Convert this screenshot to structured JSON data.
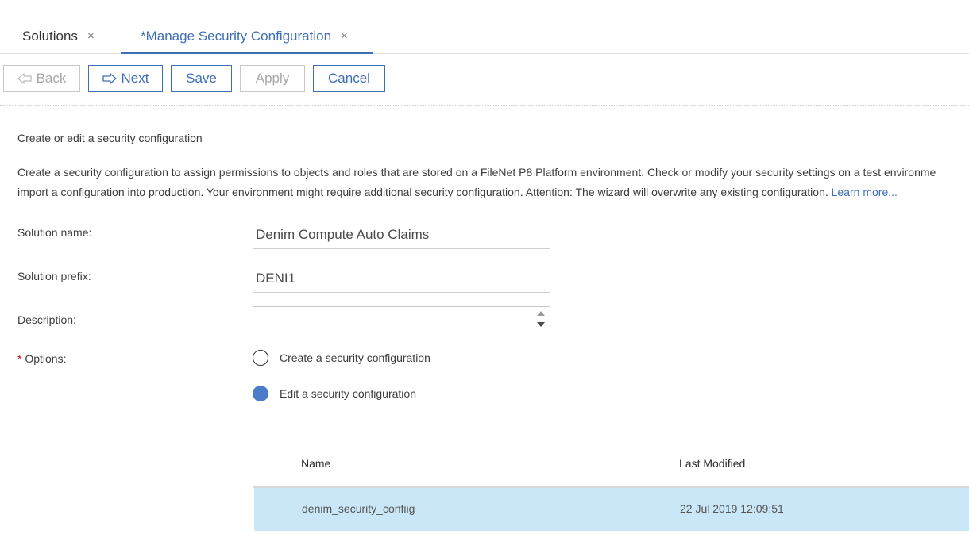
{
  "tabs": [
    {
      "label": "Solutions",
      "close": "×"
    },
    {
      "label": "*Manage Security Configuration",
      "close": "×"
    }
  ],
  "toolbar": {
    "back": "Back",
    "next": "Next",
    "save": "Save",
    "apply": "Apply",
    "cancel": "Cancel",
    "back_icon": "arrow-left-icon",
    "next_icon": "arrow-right-icon"
  },
  "page": {
    "title": "Create or edit a security configuration",
    "description_line1": "Create a security configuration to assign permissions to objects and roles that are stored on a FileNet P8 Platform environment. Check or modify your security settings on a test environme",
    "description_line2": "import a configuration into production. Your environment might require additional security configuration. Attention: The wizard will overwrite any existing configuration.",
    "learn_more": "Learn more..."
  },
  "form": {
    "solution_name_label": "Solution name:",
    "solution_name_value": "Denim Compute Auto Claims",
    "solution_prefix_label": "Solution prefix:",
    "solution_prefix_value": "DENI1",
    "description_label": "Description:",
    "description_value": "",
    "options_required": "*",
    "options_label": "Options:",
    "option_create": "Create a security configuration",
    "option_edit": "Edit a security configuration",
    "selected_option": "edit"
  },
  "grid": {
    "columns": [
      "Name",
      "Last Modified"
    ],
    "rows": [
      {
        "name": "denim_security_confiig",
        "modified": "22 Jul 2019 12:09:51",
        "selected": true
      }
    ]
  },
  "colors": {
    "accent": "#3f6fb5",
    "selected_row": "#c9e7f6",
    "radio_selected": "#4a7cc9",
    "required": "#d0021b"
  }
}
